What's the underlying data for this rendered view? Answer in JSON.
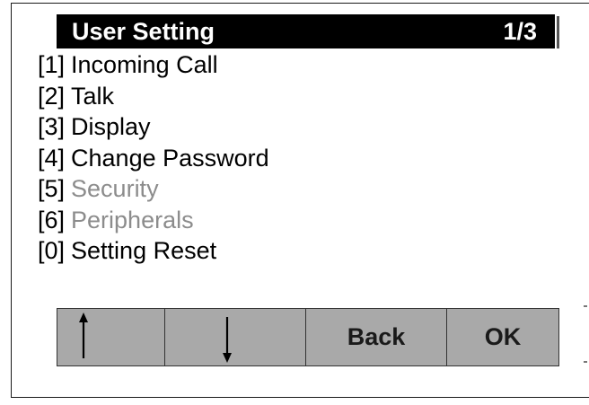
{
  "title": "User Setting",
  "page_indicator": "1/3",
  "menu": [
    {
      "key": "[1]",
      "label": "Incoming Call",
      "enabled": true
    },
    {
      "key": "[2]",
      "label": "Talk",
      "enabled": true
    },
    {
      "key": "[3]",
      "label": "Display",
      "enabled": true
    },
    {
      "key": "[4]",
      "label": "Change Password",
      "enabled": true
    },
    {
      "key": "[5]",
      "label": "Security",
      "enabled": false
    },
    {
      "key": "[6]",
      "label": "Peripherals",
      "enabled": false
    },
    {
      "key": "[0]",
      "label": "Setting Reset",
      "enabled": true
    }
  ],
  "softkeys": {
    "up_icon": "up-arrow-icon",
    "down_icon": "down-arrow-icon",
    "back": "Back",
    "ok": "OK"
  },
  "colors": {
    "titlebar_bg": "#000000",
    "titlebar_text": "#ffffff",
    "disabled_text": "#8c8c8c",
    "softkey_bg": "#a9a9a9"
  }
}
